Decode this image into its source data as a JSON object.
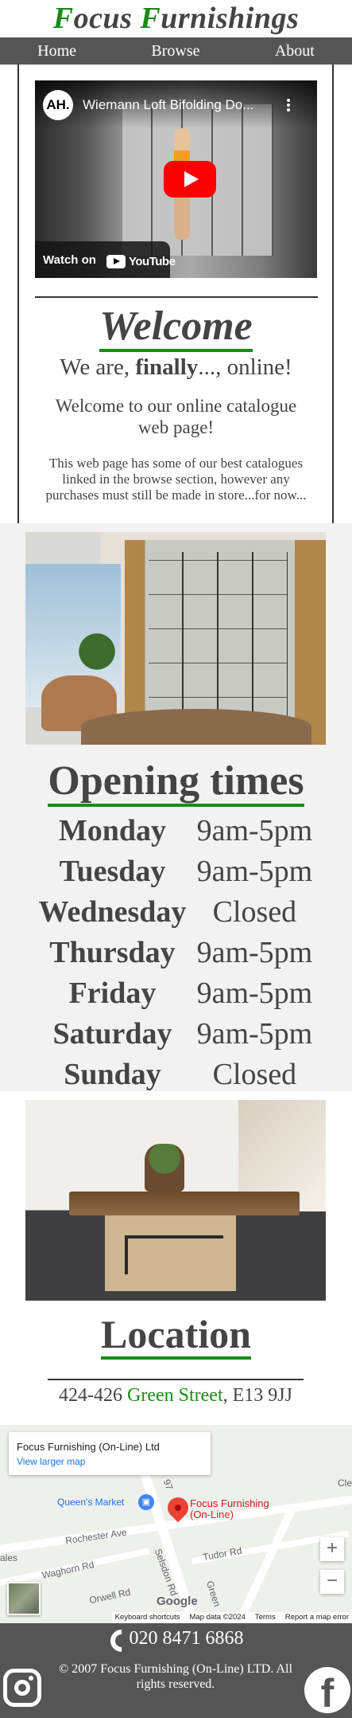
{
  "site": {
    "title_parts": [
      {
        "text": "F",
        "green": true
      },
      {
        "text": "ocus ",
        "green": false
      },
      {
        "text": "F",
        "green": true
      },
      {
        "text": "urnishings",
        "green": false
      }
    ]
  },
  "nav": {
    "items": [
      "Home",
      "Browse",
      "About"
    ]
  },
  "video": {
    "channel_avatar": "AH.",
    "title": "Wiemann Loft Bifolding Do...",
    "watch_on": "Watch on",
    "youtube": "YouTube"
  },
  "welcome": {
    "heading": "Welcome",
    "tag_prefix": "We are, ",
    "tag_bold": "finally",
    "tag_suffix": "..., online!",
    "intro": "Welcome to our online catalogue web page!",
    "body": "This web page has some of our best catalogues linked in the browse section, however any purchases must still be made in store...for now..."
  },
  "hours": {
    "heading": "Opening times",
    "rows": [
      {
        "day": "Monday",
        "time": "9am-5pm"
      },
      {
        "day": "Tuesday",
        "time": "9am-5pm"
      },
      {
        "day": "Wednesday",
        "time": "Closed"
      },
      {
        "day": "Thursday",
        "time": "9am-5pm"
      },
      {
        "day": "Friday",
        "time": "9am-5pm"
      },
      {
        "day": "Saturday",
        "time": "9am-5pm"
      },
      {
        "day": "Sunday",
        "time": "Closed"
      }
    ]
  },
  "location": {
    "heading": "Location",
    "address_number": "424-426 ",
    "address_street": "Green Street",
    "address_rest": ", E13 9JJ"
  },
  "map": {
    "place_name": "Focus Furnishing (On-Line) Ltd",
    "view_larger": "View larger map",
    "pin_label_line1": "Focus Furnishing",
    "pin_label_line2": "(On-Line)",
    "poi": "Queen's Market",
    "streets": [
      "Rochester Ave",
      "Tudor Rd",
      "Waghorn Rd",
      "Orwell Rd",
      "Selsdon Rd",
      "Green",
      "ales",
      "Cle",
      "97"
    ],
    "zoom_in": "+",
    "zoom_out": "−",
    "google": "Google",
    "attribution": [
      "Keyboard shortcuts",
      "Map data ©2024",
      "Terms",
      "Report a map error"
    ]
  },
  "footer": {
    "phone": "020 8471 6868",
    "copyright": "© 2007 Focus Furnishing (On-Line) LTD. All rights reserved.",
    "facebook_glyph": "f"
  },
  "colors": {
    "accent_green": "#1a8a1a",
    "nav_grey": "#555555",
    "text": "#444444",
    "band_grey": "#f2f2f2"
  },
  "icons": [
    "play-icon",
    "youtube-logo-icon",
    "kebab-menu-icon",
    "phone-icon",
    "instagram-icon",
    "facebook-icon",
    "map-pin-icon",
    "shopping-bag-icon"
  ]
}
